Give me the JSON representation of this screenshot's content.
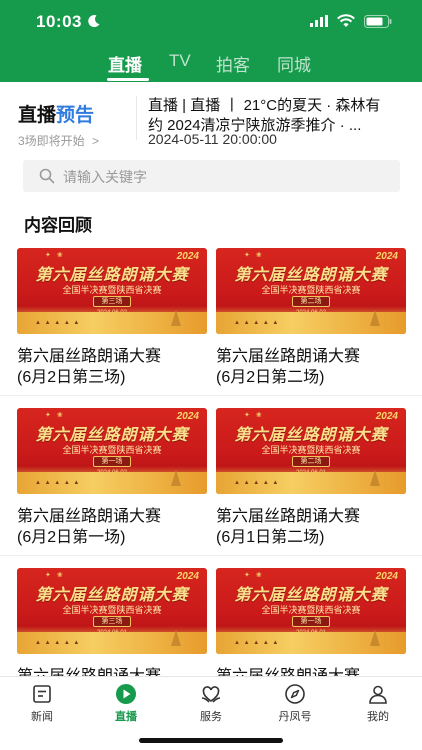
{
  "status_bar": {
    "time": "10:03"
  },
  "top_tabs": [
    {
      "label": "直播",
      "active": true
    },
    {
      "label": "TV",
      "active": false
    },
    {
      "label": "拍客",
      "active": false
    },
    {
      "label": "同城",
      "active": false
    }
  ],
  "preview": {
    "title_part1": "直播",
    "title_part2": "预告",
    "subtitle": "3场即将开始",
    "subtitle_arrow": ">",
    "event_line1": "直播 | 直播 丨 21°C的夏天 · 森林有",
    "event_line2": "约  2024清凉宁陕旅游季推介 · ...",
    "event_time": "2024-05-11 20:00:00"
  },
  "search": {
    "placeholder": "请输入关键字"
  },
  "section_title": "内容回顾",
  "thumb_text": {
    "year": "2024",
    "logos": "✦ ❀",
    "main_title": "第六届丝路朗诵大赛",
    "subtitle": "全国半决赛暨陕西省决赛",
    "camels": "▲ ▲ ▲ ▲ ▲"
  },
  "videos": [
    {
      "title": "第六届丝路朗诵大赛(6月2日第三场)",
      "line1": "第六届丝路朗诵大赛",
      "line2": "(6月2日第三场)",
      "badge": "第三场",
      "date": "2024.06.02"
    },
    {
      "title": "第六届丝路朗诵大赛(6月2日第二场)",
      "line1": "第六届丝路朗诵大赛",
      "line2": "(6月2日第二场)",
      "badge": "第二场",
      "date": "2024.06.02"
    },
    {
      "title": "第六届丝路朗诵大赛(6月2日第一场)",
      "line1": "第六届丝路朗诵大赛",
      "line2": "(6月2日第一场)",
      "badge": "第一场",
      "date": "2024.06.02"
    },
    {
      "title": "第六届丝路朗诵大赛(6月1日第二场)",
      "line1": "第六届丝路朗诵大赛",
      "line2": "(6月1日第二场)",
      "badge": "第二场",
      "date": "2024.06.01"
    },
    {
      "title": "第六届丝路朗诵大赛",
      "line1": "第六届丝路朗诵大赛",
      "line2": "",
      "badge": "第三场",
      "date": "2024.06.01"
    },
    {
      "title": "第六届丝路朗诵大赛",
      "line1": "第六届丝路朗诵大赛",
      "line2": "",
      "badge": "第一场",
      "date": "2024.06.01"
    }
  ],
  "bottom_nav": [
    {
      "label": "新闻",
      "icon": "news-icon",
      "active": false
    },
    {
      "label": "直播",
      "icon": "play-icon",
      "active": true
    },
    {
      "label": "服务",
      "icon": "service-icon",
      "active": false
    },
    {
      "label": "丹凤号",
      "icon": "compass-icon",
      "active": false
    },
    {
      "label": "我的",
      "icon": "profile-icon",
      "active": false
    }
  ],
  "colors": {
    "brand_green": "#169A4B",
    "accent_blue": "#2F7BE0",
    "poster_red": "#D7261E",
    "poster_gold": "#F6CE62"
  }
}
